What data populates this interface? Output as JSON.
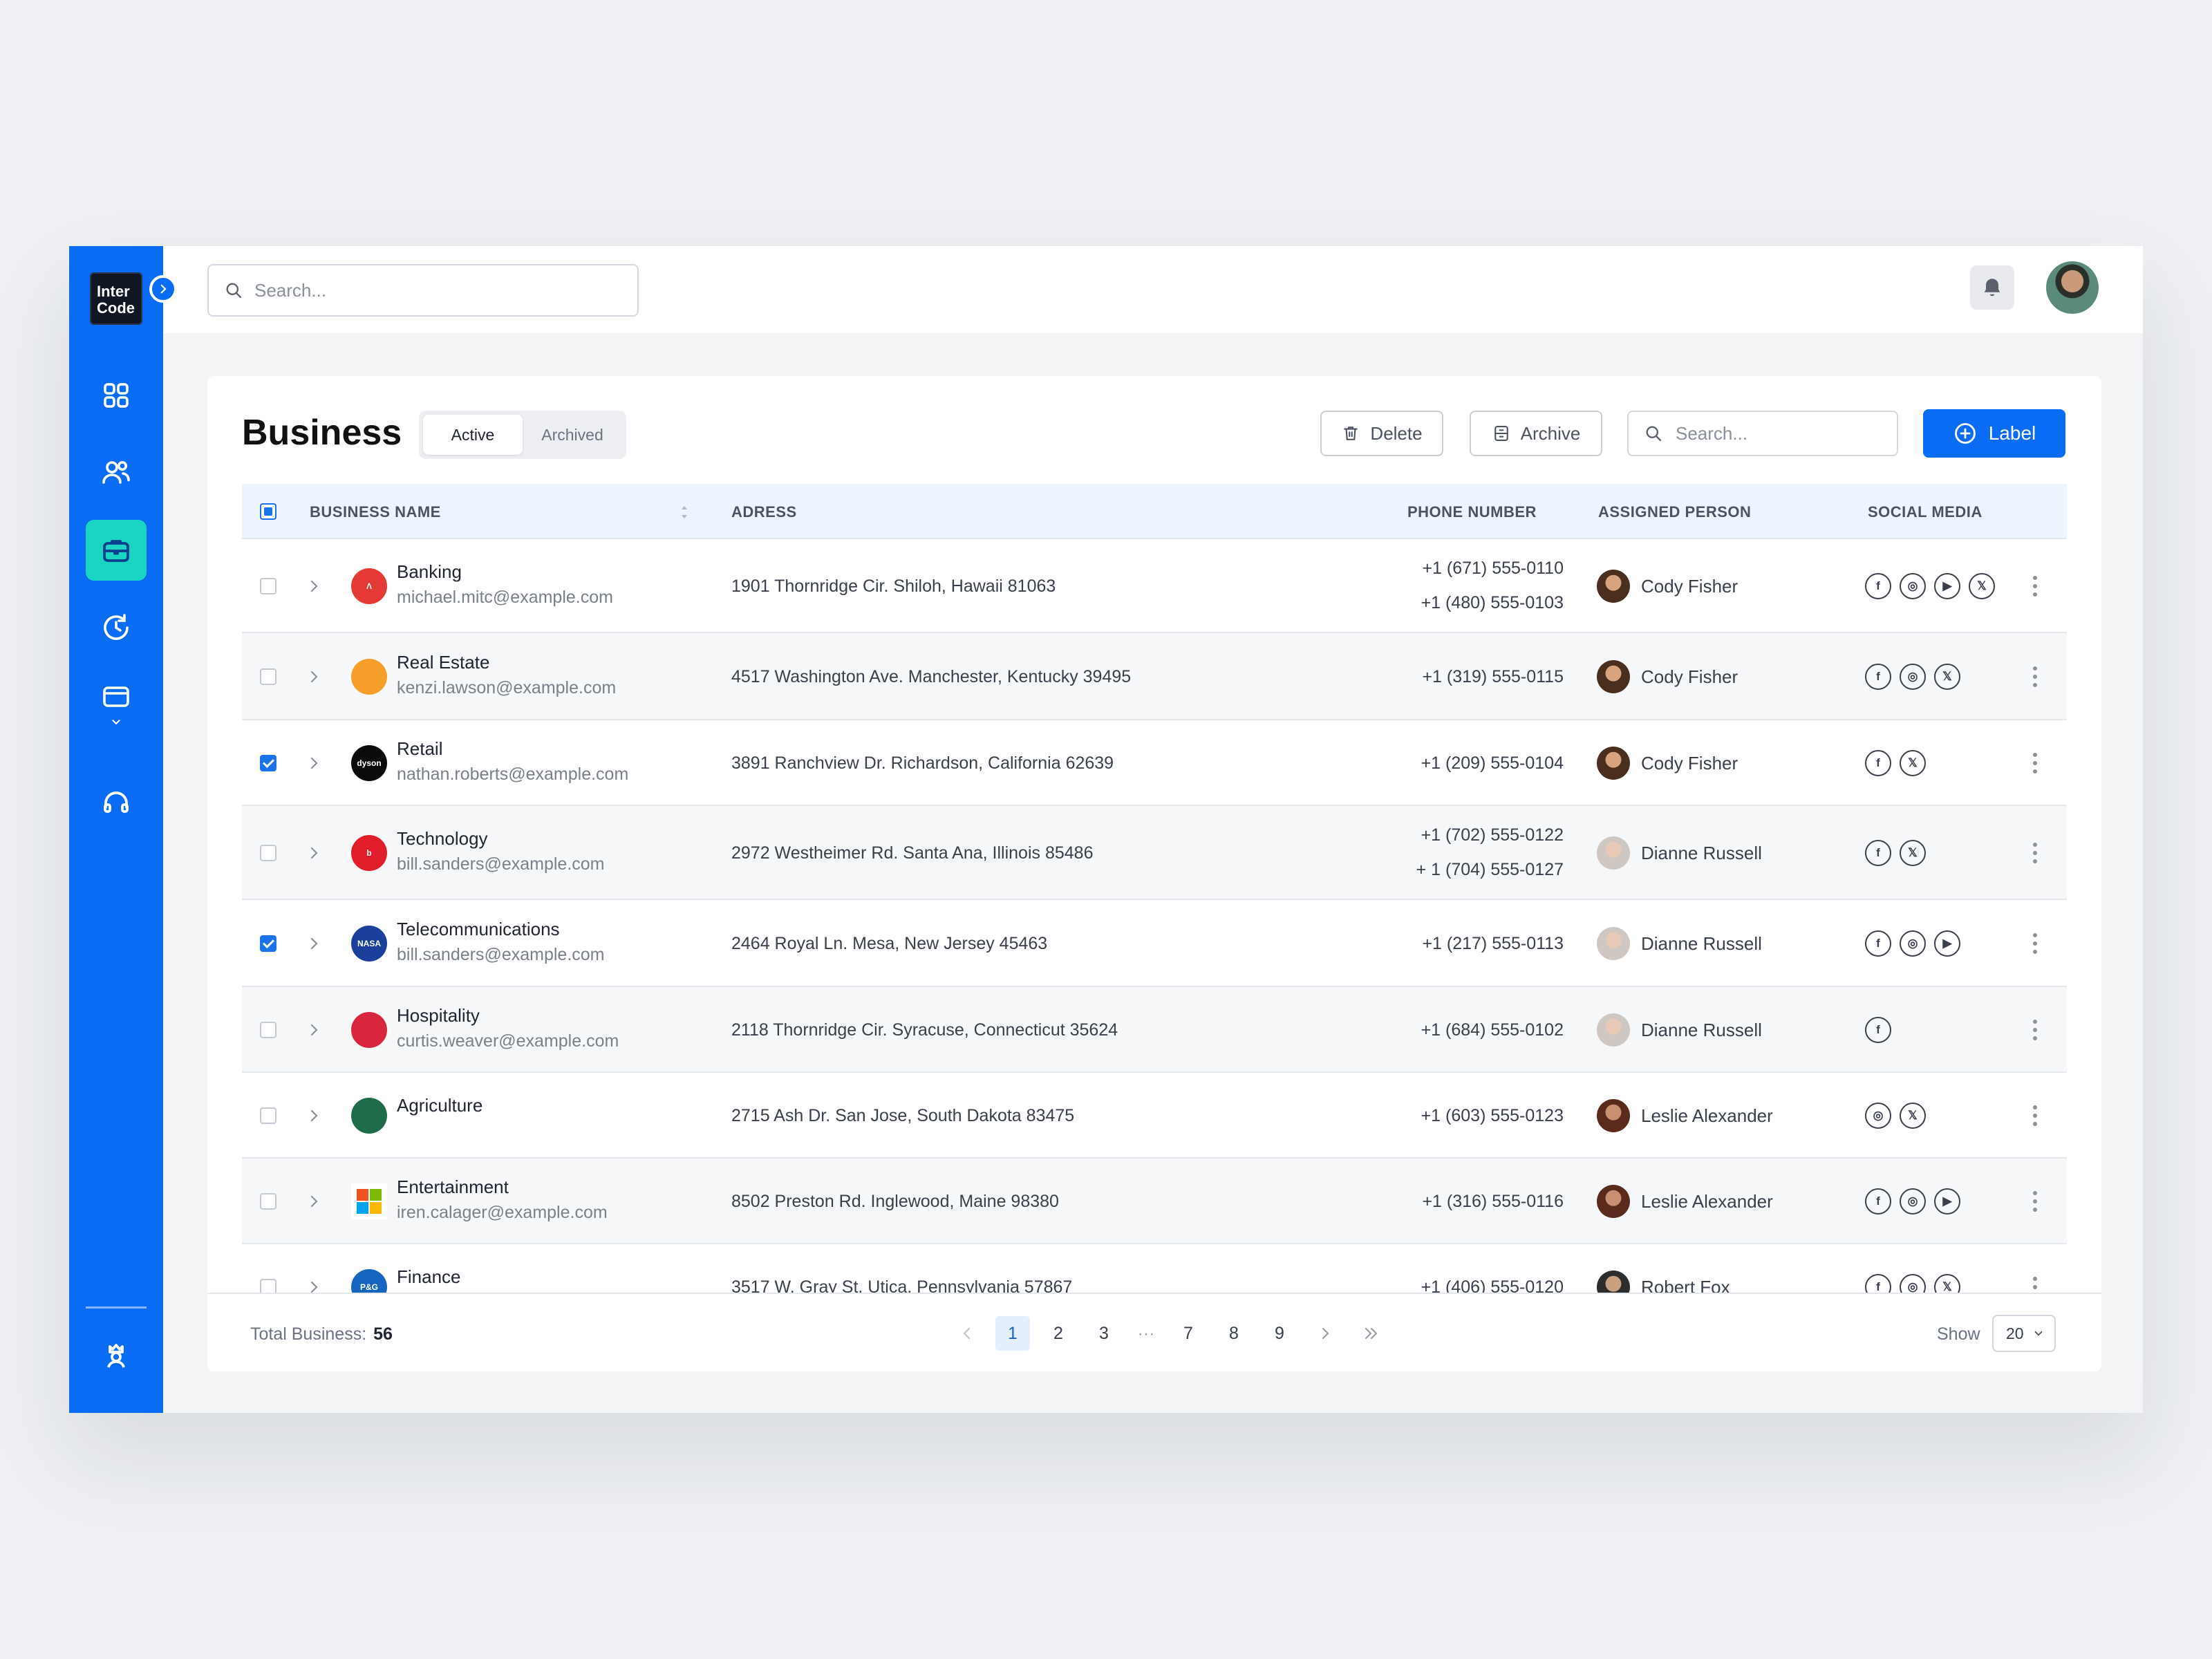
{
  "app": {
    "logo_line1": "Inter",
    "logo_line2": "Code",
    "top_search_placeholder": "Search...",
    "nav": [
      {
        "icon": "dashboard-grid-icon"
      },
      {
        "icon": "users-icon"
      },
      {
        "icon": "briefcase-icon",
        "active": true
      },
      {
        "icon": "history-icon"
      },
      {
        "icon": "wallet-icon"
      },
      {
        "icon": "headphones-icon"
      }
    ]
  },
  "page": {
    "title": "Business",
    "tabs": [
      "Active",
      "Archived"
    ],
    "active_tab": "Active",
    "delete_label": "Delete",
    "archive_label": "Archive",
    "search_placeholder": "Search...",
    "label_button": "Label"
  },
  "table": {
    "headers": {
      "name": "BUSINESS  NAME",
      "address": "ADRESS",
      "phone": "PHONE NUMBER",
      "person": "ASSIGNED PERSON",
      "social": "SOCIAL MEDIA"
    },
    "rows": [
      {
        "name": "Banking",
        "email": "michael.mitc@example.com",
        "address": "1901 Thornridge Cir. Shiloh, Hawaii 81063",
        "phones": [
          "+1 (671) 555-0110",
          "+1 (480) 555-0103"
        ],
        "person": "Cody Fisher",
        "social": [
          "facebook",
          "instagram",
          "youtube",
          "x"
        ],
        "checked": false,
        "logo_color": "#e53935",
        "logo_text": "Λ"
      },
      {
        "name": "Real Estate",
        "email": "kenzi.lawson@example.com",
        "address": "4517 Washington Ave. Manchester, Kentucky 39495",
        "phones": [
          "+1 (319) 555-0115"
        ],
        "person": "Cody Fisher",
        "social": [
          "facebook",
          "instagram",
          "x"
        ],
        "checked": false,
        "logo_color": "#f59e2b",
        "logo_text": ""
      },
      {
        "name": "Retail",
        "email": "nathan.roberts@example.com",
        "address": "3891 Ranchview Dr. Richardson, California 62639",
        "phones": [
          "+1 (209) 555-0104"
        ],
        "person": "Cody Fisher",
        "social": [
          "facebook",
          "x"
        ],
        "checked": true,
        "logo_color": "#0b0b0b",
        "logo_text": "dyson"
      },
      {
        "name": "Technology",
        "email": "bill.sanders@example.com",
        "address": "2972 Westheimer Rd. Santa Ana, Illinois 85486",
        "phones": [
          "+1 (702) 555-0122",
          "+ 1 (704) 555-0127"
        ],
        "person": "Dianne Russell",
        "social": [
          "facebook",
          "x"
        ],
        "checked": false,
        "logo_color": "#e01e2b",
        "logo_text": "b"
      },
      {
        "name": "Telecommunications",
        "email": "bill.sanders@example.com",
        "address": "2464 Royal Ln. Mesa, New Jersey 45463",
        "phones": [
          "+1 (217) 555-0113"
        ],
        "person": "Dianne Russell",
        "social": [
          "facebook",
          "instagram",
          "youtube"
        ],
        "checked": true,
        "logo_color": "#1d3f9c",
        "logo_text": "NASA"
      },
      {
        "name": "Hospitality",
        "email": "curtis.weaver@example.com",
        "address": "2118 Thornridge Cir. Syracuse, Connecticut 35624",
        "phones": [
          "+1 (684) 555-0102"
        ],
        "person": "Dianne Russell",
        "social": [
          "facebook"
        ],
        "checked": false,
        "logo_color": "#d7263d",
        "logo_text": ""
      },
      {
        "name": "Agriculture",
        "email": "",
        "address": "2715 Ash Dr. San Jose, South Dakota 83475",
        "phones": [
          "+1 (603) 555-0123"
        ],
        "person": "Leslie Alexander",
        "social": [
          "instagram",
          "x"
        ],
        "checked": false,
        "logo_color": "#1f6b4a",
        "logo_text": ""
      },
      {
        "name": "Entertainment",
        "email": "iren.calager@example.com",
        "address": "8502 Preston Rd. Inglewood, Maine 98380",
        "phones": [
          "+1 (316) 555-0116"
        ],
        "person": "Leslie Alexander",
        "social": [
          "facebook",
          "instagram",
          "youtube"
        ],
        "checked": false,
        "logo_color": "#ffffff",
        "logo_text": ""
      },
      {
        "name": "Finance",
        "email": "",
        "address": "3517 W. Gray St. Utica, Pennsylvania 57867",
        "phones": [
          "+1 (406) 555-0120"
        ],
        "person": "Robert Fox",
        "social": [
          "facebook",
          "instagram",
          "x"
        ],
        "checked": false,
        "logo_color": "#1565c0",
        "logo_text": "P&G"
      }
    ]
  },
  "footer": {
    "total_label": "Total Business:",
    "total_value": "56",
    "pages": [
      "1",
      "2",
      "3",
      "···",
      "7",
      "8",
      "9"
    ],
    "current_page": "1",
    "show_label": "Show",
    "show_value": "20"
  },
  "colors": {
    "primary": "#0a6cf5",
    "active_nav": "#19d5c1"
  }
}
